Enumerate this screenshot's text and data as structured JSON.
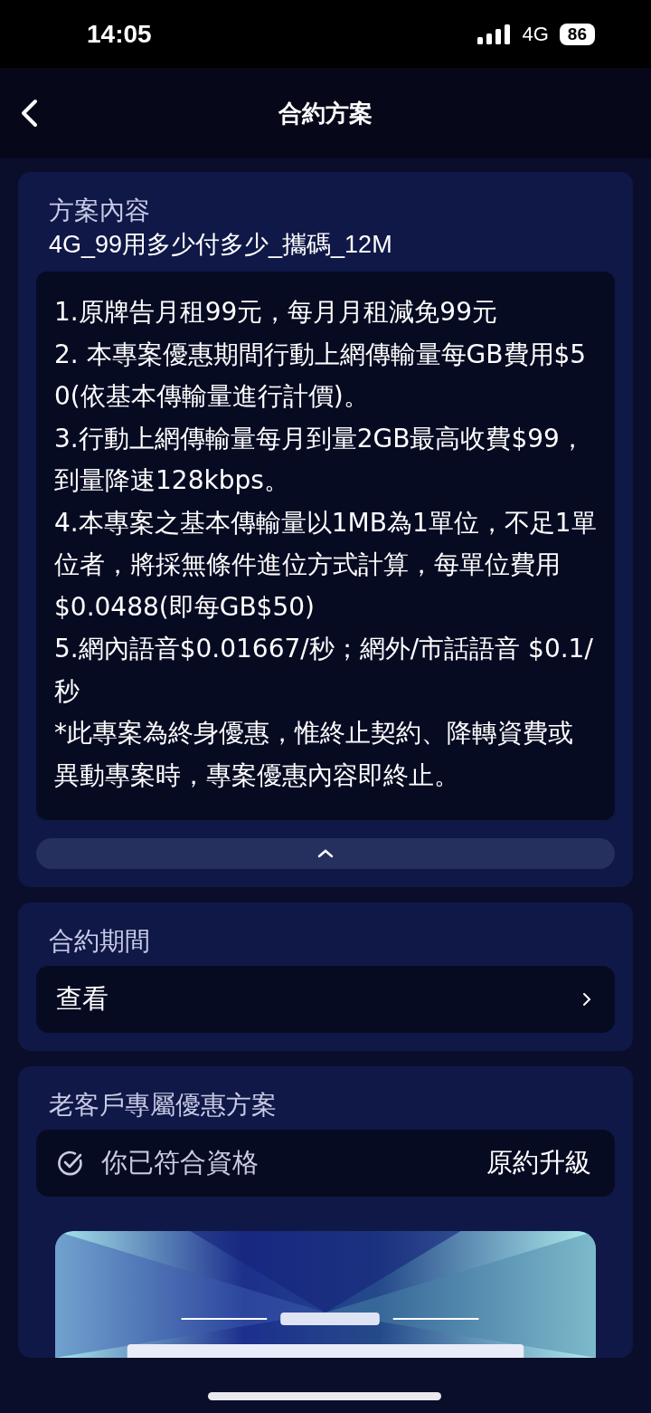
{
  "status_bar": {
    "time": "14:05",
    "network": "4G",
    "battery": "86"
  },
  "header": {
    "title": "合約方案"
  },
  "plan": {
    "heading": "方案內容",
    "name": "4G_99用多少付多少_攜碼_12M",
    "details": [
      "1.原牌告月租99元，每月月租減免99元",
      "2. 本專案優惠期間行動上網傳輸量每GB費用$50(依基本傳輸量進行計價)。",
      "3.行動上網傳輸量每月到量2GB最高收費$99，到量降速128kbps。",
      "4.本專案之基本傳輸量以1MB為1單位，不足1單位者，將採無條件進位方式計算，每單位費用$0.0488(即每GB$50)",
      "5.網內語音$0.01667/秒；網外/市話語音 $0.1/秒",
      "*此專案為終身優惠，惟終止契約、降轉資費或異動專案時，專案優惠內容即終止。"
    ],
    "expanded": true
  },
  "contract_period": {
    "heading": "合約期間",
    "link": "查看"
  },
  "loyalty": {
    "heading": "老客戶專屬優惠方案",
    "status": "你已符合資格",
    "action": "原約升級",
    "eligible": true
  }
}
